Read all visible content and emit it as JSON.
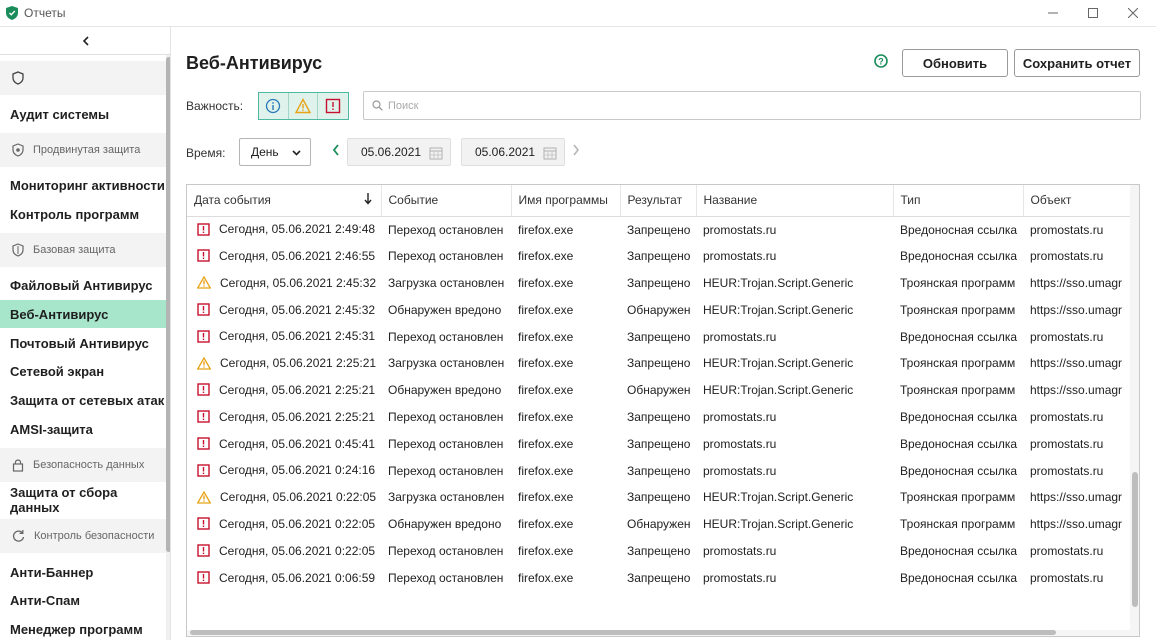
{
  "window": {
    "title": "Отчеты",
    "accent": "#1a8c5b"
  },
  "sidebar": {
    "sections": [
      {
        "label": "Продвинутая защита",
        "icon": "shield-settings-icon"
      },
      {
        "label": "Базовая защита",
        "icon": "shield-icon"
      },
      {
        "label": "Безопасность данных",
        "icon": "lock-icon"
      },
      {
        "label": "Контроль безопасности",
        "icon": "refresh-shield-icon"
      }
    ],
    "items": [
      "Аудит системы",
      "Мониторинг активности",
      "Контроль программ",
      "Файловый Антивирус",
      "Веб-Антивирус",
      "Почтовый Антивирус",
      "Сетевой экран",
      "Защита от сетевых атак",
      "AMSI-защита",
      "Защита от сбора данных",
      "Анти-Баннер",
      "Анти-Спам",
      "Менеджер программ"
    ],
    "active_index": 4,
    "active_color": "#a8e6cc"
  },
  "main": {
    "title": "Веб-Антивирус",
    "refresh_label": "Обновить",
    "save_label": "Сохранить отчет",
    "importance_label": "Важность:",
    "search_placeholder": "Поиск",
    "time_label": "Время:",
    "period_value": "День",
    "date_from": "05.06.2021",
    "date_to": "05.06.2021"
  },
  "table": {
    "columns": [
      "Дата события",
      "Событие",
      "Имя программы",
      "Результат",
      "Название",
      "Тип",
      "Объект"
    ],
    "rows": [
      {
        "sev": "critical",
        "cells": [
          "Сегодня, 05.06.2021 2:49:48",
          "Переход остановлен",
          "firefox.exe",
          "Запрещено",
          "promostats.ru",
          "Вредоносная ссылка",
          "promostats.ru"
        ]
      },
      {
        "sev": "critical",
        "cells": [
          "Сегодня, 05.06.2021 2:46:55",
          "Переход остановлен",
          "firefox.exe",
          "Запрещено",
          "promostats.ru",
          "Вредоносная ссылка",
          "promostats.ru"
        ]
      },
      {
        "sev": "warning",
        "cells": [
          "Сегодня, 05.06.2021 2:45:32",
          "Загрузка остановлен",
          "firefox.exe",
          "Запрещено",
          "HEUR:Trojan.Script.Generic",
          "Троянская программ",
          "https://sso.umagr"
        ]
      },
      {
        "sev": "critical",
        "cells": [
          "Сегодня, 05.06.2021 2:45:32",
          "Обнаружен вредоно",
          "firefox.exe",
          "Обнаружен",
          "HEUR:Trojan.Script.Generic",
          "Троянская программ",
          "https://sso.umagr"
        ]
      },
      {
        "sev": "critical",
        "cells": [
          "Сегодня, 05.06.2021 2:45:31",
          "Переход остановлен",
          "firefox.exe",
          "Запрещено",
          "promostats.ru",
          "Вредоносная ссылка",
          "promostats.ru"
        ]
      },
      {
        "sev": "warning",
        "cells": [
          "Сегодня, 05.06.2021 2:25:21",
          "Загрузка остановлен",
          "firefox.exe",
          "Запрещено",
          "HEUR:Trojan.Script.Generic",
          "Троянская программ",
          "https://sso.umagr"
        ]
      },
      {
        "sev": "critical",
        "cells": [
          "Сегодня, 05.06.2021 2:25:21",
          "Обнаружен вредоно",
          "firefox.exe",
          "Обнаружен",
          "HEUR:Trojan.Script.Generic",
          "Троянская программ",
          "https://sso.umagr"
        ]
      },
      {
        "sev": "critical",
        "cells": [
          "Сегодня, 05.06.2021 2:25:21",
          "Переход остановлен",
          "firefox.exe",
          "Запрещено",
          "promostats.ru",
          "Вредоносная ссылка",
          "promostats.ru"
        ]
      },
      {
        "sev": "critical",
        "cells": [
          "Сегодня, 05.06.2021 0:45:41",
          "Переход остановлен",
          "firefox.exe",
          "Запрещено",
          "promostats.ru",
          "Вредоносная ссылка",
          "promostats.ru"
        ]
      },
      {
        "sev": "critical",
        "cells": [
          "Сегодня, 05.06.2021 0:24:16",
          "Переход остановлен",
          "firefox.exe",
          "Запрещено",
          "promostats.ru",
          "Вредоносная ссылка",
          "promostats.ru"
        ]
      },
      {
        "sev": "warning",
        "cells": [
          "Сегодня, 05.06.2021 0:22:05",
          "Загрузка остановлен",
          "firefox.exe",
          "Запрещено",
          "HEUR:Trojan.Script.Generic",
          "Троянская программ",
          "https://sso.umagr"
        ]
      },
      {
        "sev": "critical",
        "cells": [
          "Сегодня, 05.06.2021 0:22:05",
          "Обнаружен вредоно",
          "firefox.exe",
          "Обнаружен",
          "HEUR:Trojan.Script.Generic",
          "Троянская программ",
          "https://sso.umagr"
        ]
      },
      {
        "sev": "critical",
        "cells": [
          "Сегодня, 05.06.2021 0:22:05",
          "Переход остановлен",
          "firefox.exe",
          "Запрещено",
          "promostats.ru",
          "Вредоносная ссылка",
          "promostats.ru"
        ]
      },
      {
        "sev": "critical",
        "cells": [
          "Сегодня, 05.06.2021 0:06:59",
          "Переход остановлен",
          "firefox.exe",
          "Запрещено",
          "promostats.ru",
          "Вредоносная ссылка",
          "promostats.ru"
        ]
      }
    ],
    "critical_color": "#c8102e",
    "warning_color": "#e8a317"
  }
}
